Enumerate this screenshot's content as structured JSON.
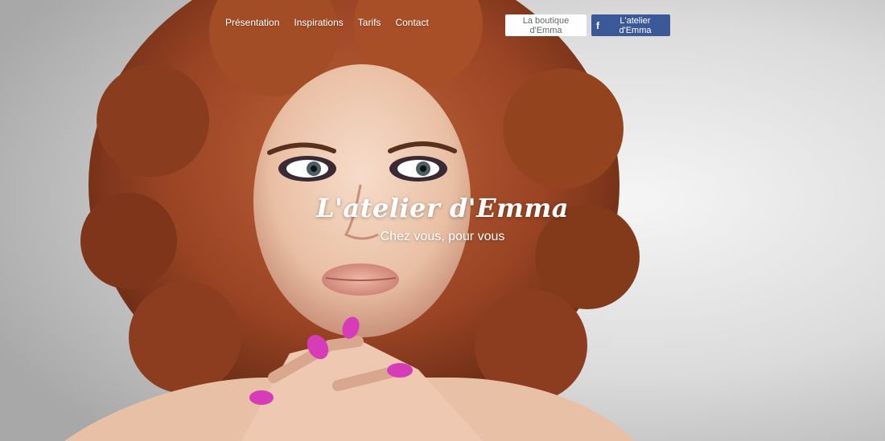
{
  "nav": {
    "items": [
      {
        "label": "Présentation"
      },
      {
        "label": "Inspirations"
      },
      {
        "label": "Tarifs"
      },
      {
        "label": "Contact"
      }
    ]
  },
  "actions": {
    "boutique_label": "La boutique d'Emma",
    "facebook_label": "L'atelier d'Emma",
    "facebook_icon": "facebook-icon"
  },
  "hero": {
    "title": "L'atelier d'Emma",
    "subtitle": "Chez vous, pour vous",
    "image": "hero-photo-woman-curly-red-hair"
  },
  "colors": {
    "facebook_blue": "#3b5998",
    "text_white": "#ffffff",
    "nail_magenta": "#d63bb8",
    "hair_auburn": "#a8492a"
  }
}
